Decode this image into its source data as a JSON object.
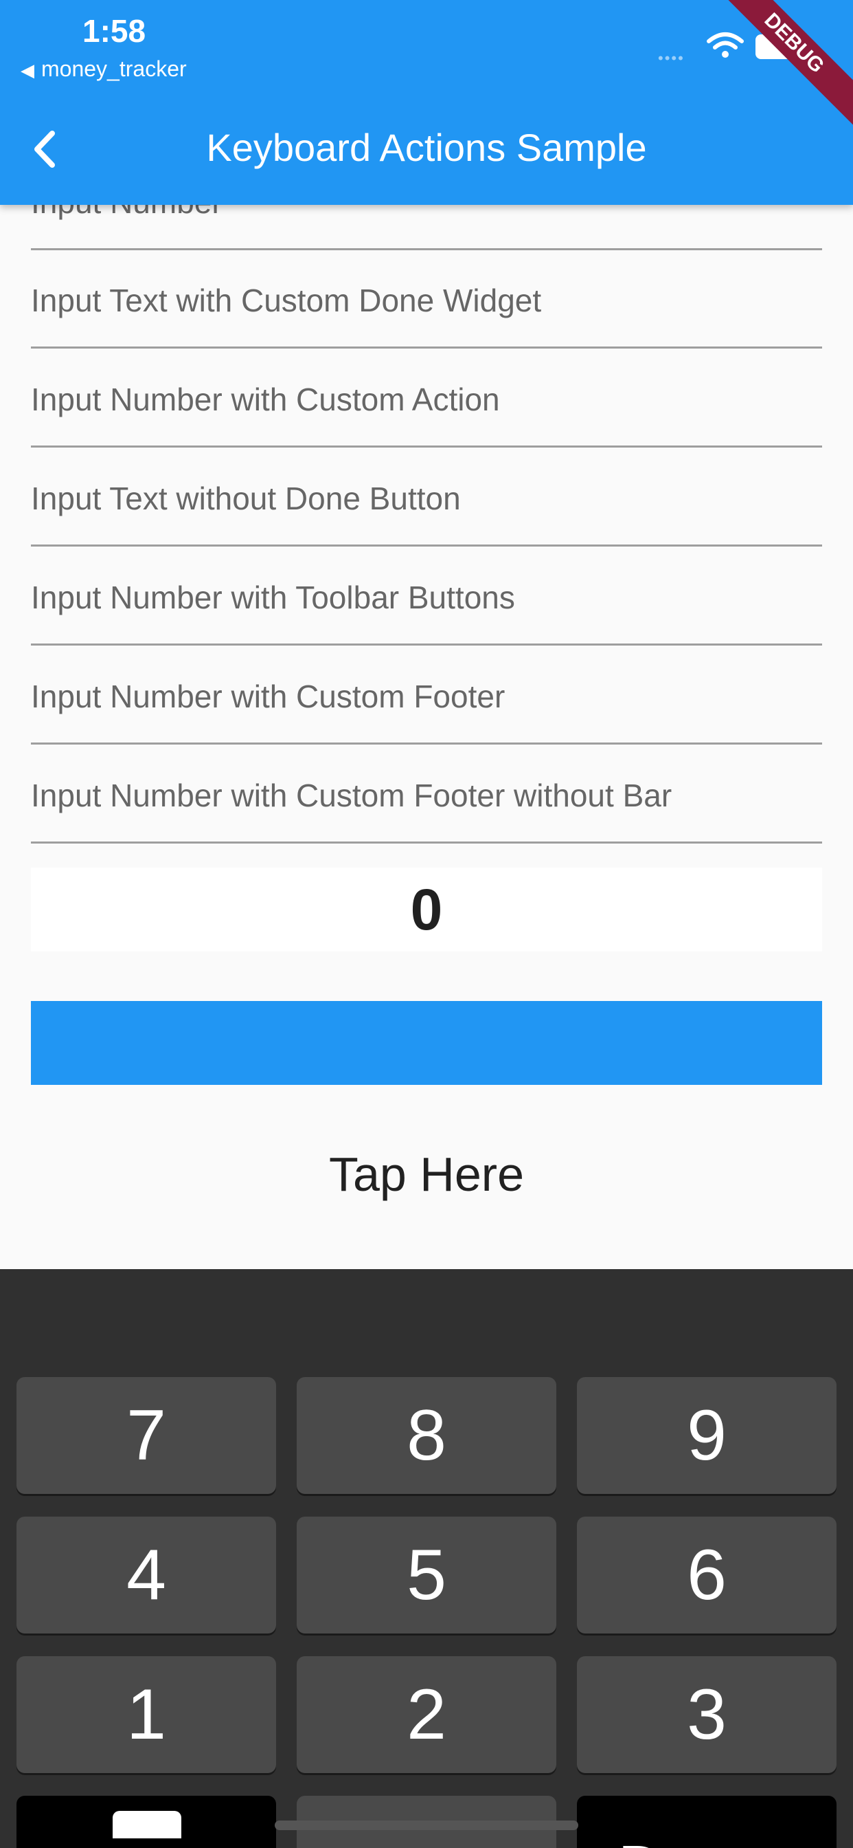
{
  "status_bar": {
    "time": "1:58",
    "back_app": "money_tracker",
    "debug_banner": "DEBUG"
  },
  "app_bar": {
    "title": "Keyboard Actions Sample"
  },
  "colors": {
    "primary": "#2196f3",
    "debug_banner": "#8b1a3a",
    "keyboard_bg": "#303030",
    "key_bg": "#4a4a4a"
  },
  "fields": [
    {
      "label": "Input Number"
    },
    {
      "label": "Input Text with Custom Done Widget"
    },
    {
      "label": "Input Number with Custom Action"
    },
    {
      "label": "Input Text without Done Button"
    },
    {
      "label": "Input Number with Toolbar Buttons"
    },
    {
      "label": "Input Number with Custom Footer"
    },
    {
      "label": "Input Number with Custom Footer without Bar"
    }
  ],
  "counter": {
    "value": "0"
  },
  "tap_here": "Tap Here",
  "keyboard": {
    "keys": [
      "7",
      "8",
      "9",
      "4",
      "5",
      "6",
      "1",
      "2",
      "3"
    ],
    "partial_right_label": "D"
  }
}
